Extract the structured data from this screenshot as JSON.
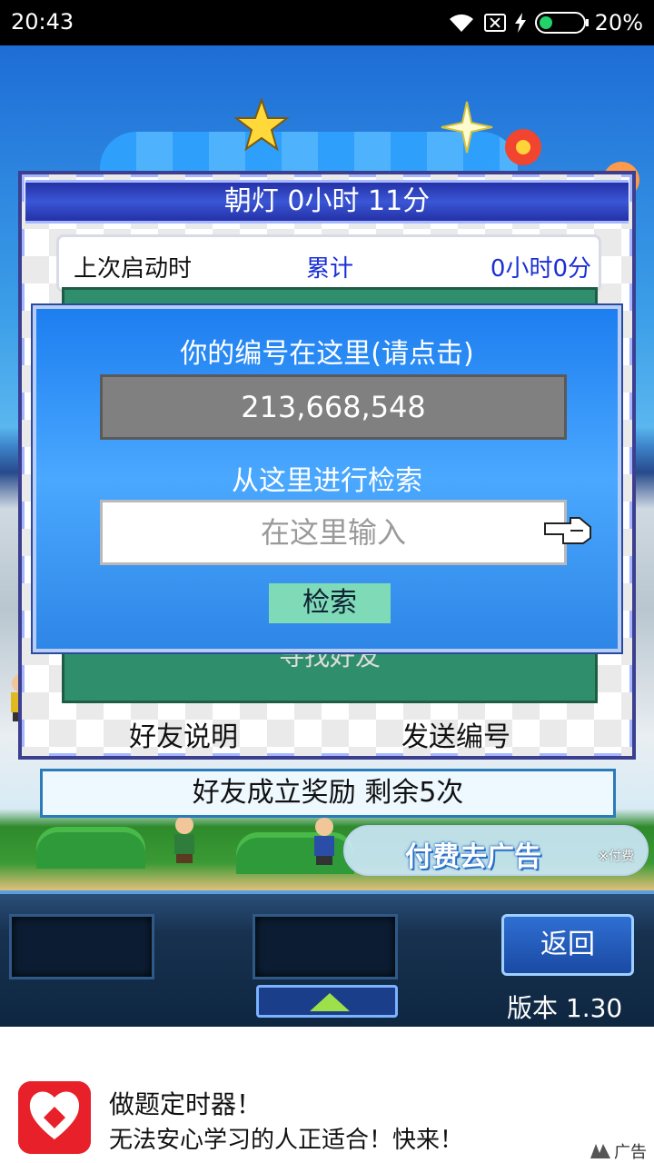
{
  "status_bar": {
    "time": "20:43",
    "battery": "20%",
    "icons": [
      "wifi-icon",
      "sim-off-icon",
      "charging-bolt-icon",
      "battery-icon"
    ]
  },
  "window": {
    "title": "朝灯  0小时 11分",
    "stats": {
      "label": "上次启动时",
      "middle": "累计",
      "value": "0小时0分"
    },
    "panel_text": "寻找好友",
    "links": {
      "explain": "好友说明",
      "send_id": "发送编号"
    }
  },
  "popup": {
    "id_heading": "你的编号在这里(请点击)",
    "id_value": "213,668,548",
    "search_heading": "从这里进行检索",
    "search_placeholder": "在这里输入",
    "search_button": "检索"
  },
  "reward": {
    "text": "好友成立奖励  剩余5次"
  },
  "ad_pill": {
    "label": "付费去广告",
    "note": "※付费"
  },
  "controls": {
    "back_label": "返回",
    "version": "版本 1.30"
  },
  "banner": {
    "title": "做题定时器！",
    "subtitle": "无法安心学习的人正适合！快来！",
    "ad_label": "广告"
  },
  "colors": {
    "title_bar": "#2431a6",
    "popup_blue": "#1d7ef0",
    "panel_green": "#2f8f6c",
    "search_button": "#7fdab8",
    "accent_text": "#1a2fd6"
  }
}
